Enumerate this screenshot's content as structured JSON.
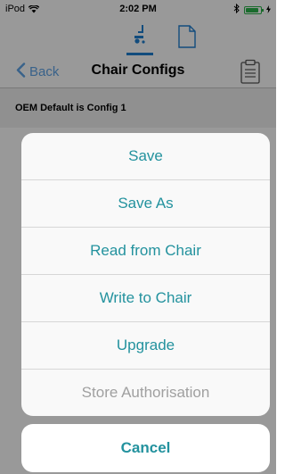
{
  "status_bar": {
    "carrier": "iPod",
    "time": "2:02 PM",
    "battery_level": 0.9
  },
  "tabs": [
    {
      "icon": "chair-config-icon",
      "selected": true
    },
    {
      "icon": "document-icon",
      "selected": false
    }
  ],
  "nav": {
    "back_label": "Back",
    "title": "Chair Configs"
  },
  "section": {
    "header": "OEM Default is Config 1"
  },
  "action_sheet": {
    "items": [
      {
        "label": "Save",
        "enabled": true
      },
      {
        "label": "Save As",
        "enabled": true
      },
      {
        "label": "Read from Chair",
        "enabled": true
      },
      {
        "label": "Write to Chair",
        "enabled": true
      },
      {
        "label": "Upgrade",
        "enabled": true
      },
      {
        "label": "Store Authorisation",
        "enabled": false
      }
    ],
    "cancel_label": "Cancel"
  },
  "colors": {
    "accent": "#23929e",
    "back_blue": "#5fa3e6",
    "tab_underline": "#1f7fd1",
    "battery": "#2ab34a",
    "disabled": "#a0a0a0"
  }
}
